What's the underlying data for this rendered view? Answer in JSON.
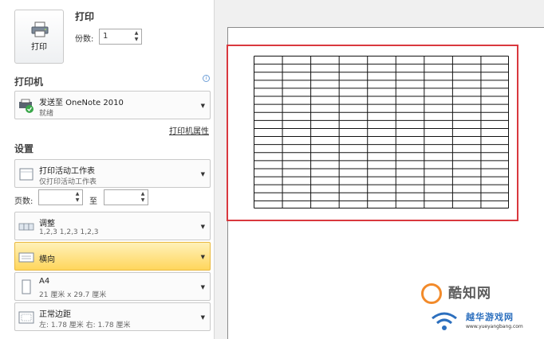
{
  "print": {
    "button_label": "打印",
    "heading": "打印",
    "copies_label": "份数:",
    "copies_value": "1"
  },
  "printer": {
    "section_title": "打印机",
    "name": "发送至 OneNote 2010",
    "status": "就绪",
    "properties_link": "打印机属性"
  },
  "settings": {
    "section_title": "设置",
    "scope": {
      "main": "打印活动工作表",
      "sub": "仅打印活动工作表"
    },
    "pages_label": "页数:",
    "to_label": "至",
    "collate": {
      "main": "调整",
      "sub": "1,2,3    1,2,3    1,2,3"
    },
    "orientation": {
      "main": "横向"
    },
    "paper": {
      "main": "A4",
      "sub": "21 厘米 x 29.7 厘米"
    },
    "margins": {
      "main": "正常边距",
      "sub": "左: 1.78 厘米    右: 1.78 厘米"
    }
  },
  "preview": {
    "table_columns": 9,
    "table_rows": 19
  },
  "watermark": {
    "brand": "酷知网",
    "site": "越华游戏网",
    "url": "www.yueyangbang.com"
  },
  "colors": {
    "highlight_frame": "#d9383e",
    "selected_option": "#ffd65c",
    "watermark_orange": "#f28a2a",
    "watermark_blue": "#2c6fbe"
  }
}
